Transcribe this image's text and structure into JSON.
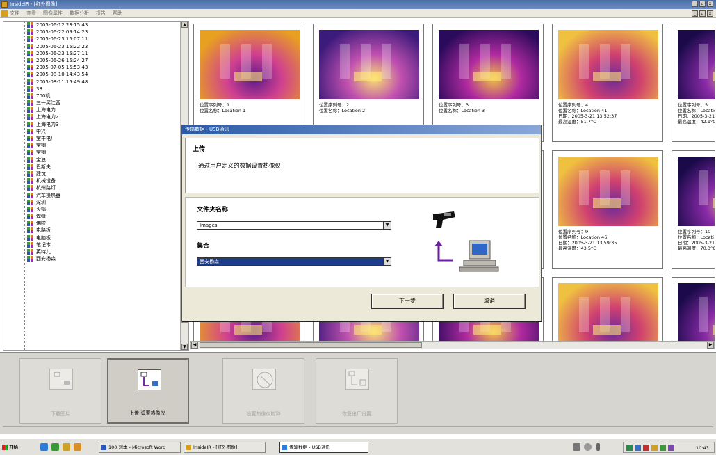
{
  "window": {
    "title": "InsideIR - [红外图像]",
    "controls": [
      "_",
      "▫",
      "x"
    ]
  },
  "menu": {
    "items": [
      "文件",
      "查看",
      "图像属性",
      "数据分析",
      "报告",
      "帮助"
    ]
  },
  "tree": {
    "items": [
      {
        "label": "2005-06-12 23:15:43",
        "type": "date"
      },
      {
        "label": "2005-06-22 09:14:23",
        "type": "date"
      },
      {
        "label": "2005-06-23 15:07:11",
        "type": "date"
      },
      {
        "label": "2005-06-23 15:22:23",
        "type": "date"
      },
      {
        "label": "2005-06-23 15:27:11",
        "type": "date"
      },
      {
        "label": "2005-06-26 15:24:27",
        "type": "date"
      },
      {
        "label": "2005-07-05 15:53:43",
        "type": "date"
      },
      {
        "label": "2005-08-10 14:43:54",
        "type": "date"
      },
      {
        "label": "2005-08-11 15:49:48",
        "type": "date"
      },
      {
        "label": "38",
        "type": "folder"
      },
      {
        "label": "700机",
        "type": "folder"
      },
      {
        "label": "三一买江西",
        "type": "folder"
      },
      {
        "label": "上海电力",
        "type": "folder"
      },
      {
        "label": "上海电力2",
        "type": "folder"
      },
      {
        "label": "上海电力3",
        "type": "folder"
      },
      {
        "label": "中兴",
        "type": "folder"
      },
      {
        "label": "宝丰电厂",
        "type": "folder"
      },
      {
        "label": "宝钢",
        "type": "folder"
      },
      {
        "label": "宝钢",
        "type": "folder"
      },
      {
        "label": "宝浪",
        "type": "folder"
      },
      {
        "label": "巴斯夫",
        "type": "folder"
      },
      {
        "label": "建筑",
        "type": "folder"
      },
      {
        "label": "机械设备",
        "type": "folder"
      },
      {
        "label": "杭州路灯",
        "type": "folder"
      },
      {
        "label": "汽车换热器",
        "type": "folder"
      },
      {
        "label": "深圳",
        "type": "folder"
      },
      {
        "label": "火锅",
        "type": "folder"
      },
      {
        "label": "焊缝",
        "type": "folder"
      },
      {
        "label": "佛啦",
        "type": "folder"
      },
      {
        "label": "电路板",
        "type": "folder"
      },
      {
        "label": "电脑板",
        "type": "folder"
      },
      {
        "label": "笔记本",
        "type": "folder"
      },
      {
        "label": "英特儿",
        "type": "folder"
      },
      {
        "label": "西安杨森",
        "type": "folder"
      }
    ]
  },
  "thumbnails": [
    {
      "meta": "位置序列号：1\n位置名称：Location 1"
    },
    {
      "meta": "位置序列号：2\n位置名称：Location 2"
    },
    {
      "meta": "位置序列号：3\n位置名称：Location 3"
    },
    {
      "meta": "位置序列号：4\n位置名称：Location 41\n日期：2005-3-21 13:52:37\n最高温度：51.7°C"
    },
    {
      "meta": "位置序列号：5\n位置名称：Location\n日期：2005-3-21 1\n最高温度：42.1°C"
    },
    {
      "meta": ""
    },
    {
      "meta": ""
    },
    {
      "meta": ""
    },
    {
      "meta": "位置序列号：9\n位置名称：Location 46\n日期：2005-3-21 13:59:35\n最高温度：43.5°C"
    },
    {
      "meta": "位置序列号：10\n位置名称：Locati\n日期：2005-3-21 1\n最高温度：70.3°C"
    },
    {
      "meta": ""
    },
    {
      "meta": ""
    },
    {
      "meta": ""
    },
    {
      "meta": ""
    },
    {
      "meta": ""
    }
  ],
  "tools": [
    {
      "label": "下载图片",
      "active": false
    },
    {
      "label": "上传-设置热像仪-",
      "active": true
    },
    {
      "label": "设置热像仪时钟",
      "active": false
    },
    {
      "label": "恢复出厂设置",
      "active": false
    }
  ],
  "dialog": {
    "title": "传输数据 - USB通讯",
    "heading": "上传",
    "subheading": "通过用户定义的数据设置热像仪",
    "folder_label": "文件夹名称",
    "folder_value": "Images",
    "set_label": "集合",
    "set_value": "西安杨森",
    "next_button": "下一步",
    "cancel_button": "取消"
  },
  "taskbar": {
    "start": "开始",
    "tasks": [
      {
        "label": "100 想本 - Microsoft Word",
        "active": false
      },
      {
        "label": "InsideIR - [红外图像]",
        "active": false
      },
      {
        "label": "传输数据 - USB通讯",
        "active": true
      }
    ],
    "clock": "10:43"
  }
}
